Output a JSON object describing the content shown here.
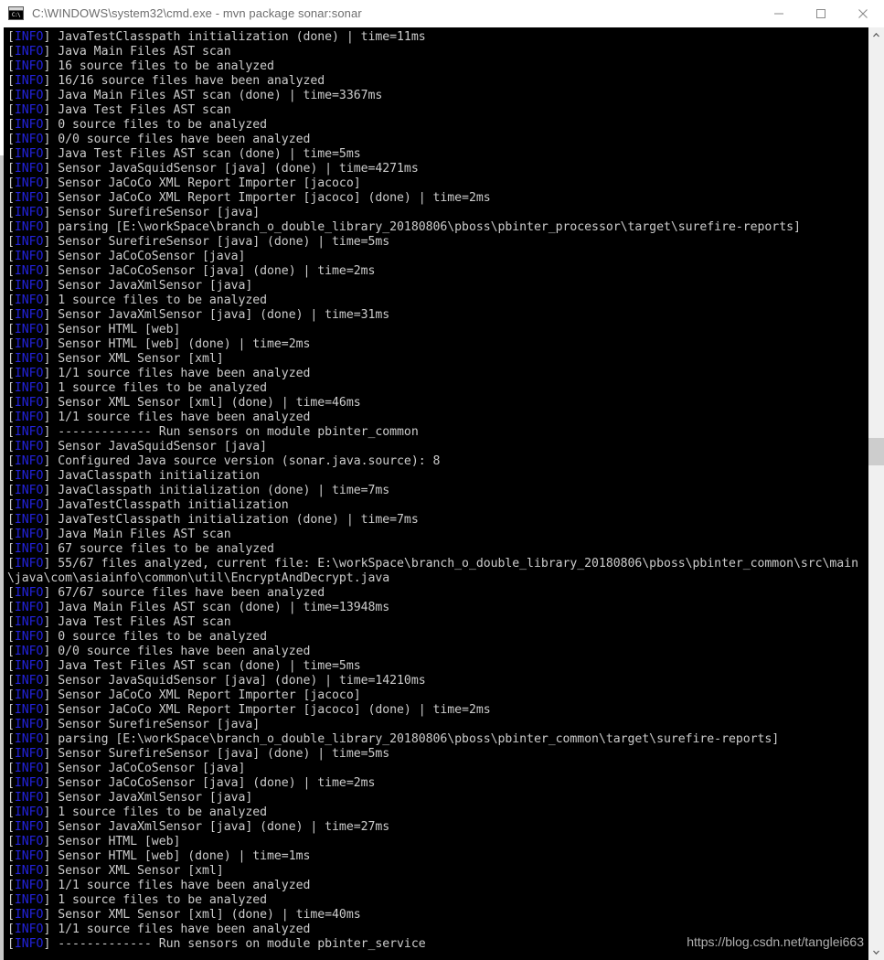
{
  "window": {
    "title": "C:\\WINDOWS\\system32\\cmd.exe - mvn  package sonar:sonar",
    "icon": "cmd-console-icon",
    "controls": {
      "minimize": "minimize-icon",
      "maximize": "maximize-icon",
      "close": "close-icon"
    }
  },
  "scrollbar": {
    "up_arrow": "chevron-up-icon",
    "down_arrow": "chevron-down-icon"
  },
  "watermark": {
    "text": "https://blog.csdn.net/tanglei663"
  },
  "console": {
    "log_level": "[INFO]",
    "level_color": "#2222dd",
    "text_color": "#cccccc",
    "background": "#000000",
    "lines": [
      "JavaTestClasspath initialization (done) | time=11ms",
      "Java Main Files AST scan",
      "16 source files to be analyzed",
      "16/16 source files have been analyzed",
      "Java Main Files AST scan (done) | time=3367ms",
      "Java Test Files AST scan",
      "0 source files to be analyzed",
      "0/0 source files have been analyzed",
      "Java Test Files AST scan (done) | time=5ms",
      "Sensor JavaSquidSensor [java] (done) | time=4271ms",
      "Sensor JaCoCo XML Report Importer [jacoco]",
      "Sensor JaCoCo XML Report Importer [jacoco] (done) | time=2ms",
      "Sensor SurefireSensor [java]",
      "parsing [E:\\workSpace\\branch_o_double_library_20180806\\pboss\\pbinter_processor\\target\\surefire-reports]",
      "Sensor SurefireSensor [java] (done) | time=5ms",
      "Sensor JaCoCoSensor [java]",
      "Sensor JaCoCoSensor [java] (done) | time=2ms",
      "Sensor JavaXmlSensor [java]",
      "1 source files to be analyzed",
      "Sensor JavaXmlSensor [java] (done) | time=31ms",
      "Sensor HTML [web]",
      "Sensor HTML [web] (done) | time=2ms",
      "Sensor XML Sensor [xml]",
      "1/1 source files have been analyzed",
      "1 source files to be analyzed",
      "Sensor XML Sensor [xml] (done) | time=46ms",
      "1/1 source files have been analyzed",
      "------------- Run sensors on module pbinter_common",
      "Sensor JavaSquidSensor [java]",
      "Configured Java source version (sonar.java.source): 8",
      "JavaClasspath initialization",
      "JavaClasspath initialization (done) | time=7ms",
      "JavaTestClasspath initialization",
      "JavaTestClasspath initialization (done) | time=7ms",
      "Java Main Files AST scan",
      "67 source files to be analyzed",
      "55/67 files analyzed, current file: E:\\workSpace\\branch_o_double_library_20180806\\pboss\\pbinter_common\\src\\main\\java\\com\\asiainfo\\common\\util\\EncryptAndDecrypt.java",
      "67/67 source files have been analyzed",
      "Java Main Files AST scan (done) | time=13948ms",
      "Java Test Files AST scan",
      "0 source files to be analyzed",
      "0/0 source files have been analyzed",
      "Java Test Files AST scan (done) | time=5ms",
      "Sensor JavaSquidSensor [java] (done) | time=14210ms",
      "Sensor JaCoCo XML Report Importer [jacoco]",
      "Sensor JaCoCo XML Report Importer [jacoco] (done) | time=2ms",
      "Sensor SurefireSensor [java]",
      "parsing [E:\\workSpace\\branch_o_double_library_20180806\\pboss\\pbinter_common\\target\\surefire-reports]",
      "Sensor SurefireSensor [java] (done) | time=5ms",
      "Sensor JaCoCoSensor [java]",
      "Sensor JaCoCoSensor [java] (done) | time=2ms",
      "Sensor JavaXmlSensor [java]",
      "1 source files to be analyzed",
      "Sensor JavaXmlSensor [java] (done) | time=27ms",
      "Sensor HTML [web]",
      "Sensor HTML [web] (done) | time=1ms",
      "Sensor XML Sensor [xml]",
      "1/1 source files have been analyzed",
      "1 source files to be analyzed",
      "Sensor XML Sensor [xml] (done) | time=40ms",
      "1/1 source files have been analyzed",
      "------------- Run sensors on module pbinter_service"
    ]
  }
}
